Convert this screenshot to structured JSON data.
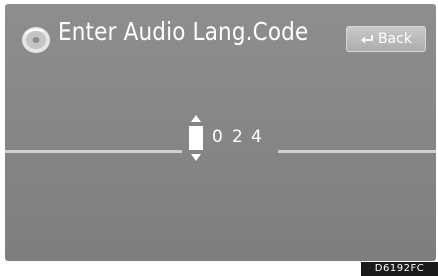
{
  "header": {
    "title": "Enter Audio Lang.Code",
    "title_icon": "disc-icon",
    "back_label": "Back",
    "back_icon": "return-arrow-icon"
  },
  "code_entry": {
    "digits": [
      "0",
      "2",
      "4"
    ],
    "up_icon": "triangle-up-icon",
    "down_icon": "triangle-down-icon"
  },
  "figure_code": "D6192FC",
  "colors": {
    "screen_bg": "#878787",
    "text": "#ffffff",
    "button_bg": "#bbbbbb"
  }
}
